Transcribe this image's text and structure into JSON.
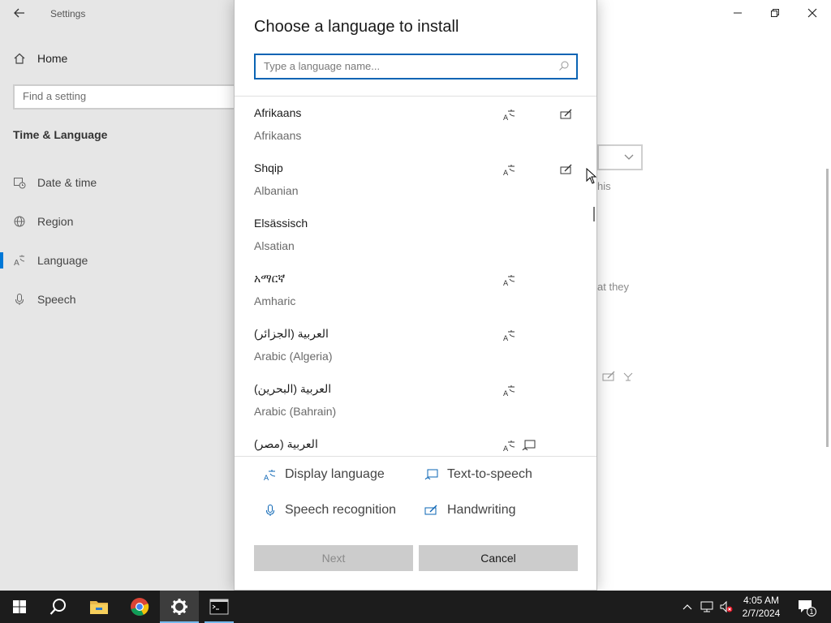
{
  "window": {
    "title": "Settings",
    "controls": {
      "minimize": "minimize",
      "restore": "restore",
      "close": "close"
    }
  },
  "nav": {
    "home": "Home",
    "search_placeholder": "Find a setting",
    "section_title": "Time & Language",
    "items": [
      {
        "label": "Date & time",
        "icon": "calendar-clock-icon",
        "active": false
      },
      {
        "label": "Region",
        "icon": "globe-icon",
        "active": false
      },
      {
        "label": "Language",
        "icon": "language-icon",
        "active": true
      },
      {
        "label": "Speech",
        "icon": "microphone-icon",
        "active": false
      }
    ]
  },
  "background_text": {
    "fragment1": "his",
    "fragment2": "at they"
  },
  "dialog": {
    "title": "Choose a language to install",
    "search_placeholder": "Type a language name...",
    "languages": [
      {
        "native": "Afrikaans",
        "english": "Afrikaans",
        "features": [
          "display-language",
          "handwriting"
        ]
      },
      {
        "native": "Shqip",
        "english": "Albanian",
        "features": [
          "display-language",
          "handwriting"
        ]
      },
      {
        "native": "Elsässisch",
        "english": "Alsatian",
        "features": []
      },
      {
        "native": "አማርኛ",
        "english": "Amharic",
        "features": [
          "display-language"
        ]
      },
      {
        "native": "العربية (الجزائر)",
        "english": "Arabic (Algeria)",
        "features": [
          "display-language"
        ]
      },
      {
        "native": "العربية (البحرين)",
        "english": "Arabic (Bahrain)",
        "features": [
          "display-language"
        ]
      },
      {
        "native": "العربية (مصر)",
        "english": "",
        "features": [
          "display-language",
          "text-to-speech"
        ]
      }
    ],
    "legend": {
      "display_language": "Display language",
      "text_to_speech": "Text-to-speech",
      "speech_recognition": "Speech recognition",
      "handwriting": "Handwriting"
    },
    "buttons": {
      "next": "Next",
      "cancel": "Cancel"
    }
  },
  "taskbar": {
    "apps": [
      "start",
      "search",
      "file-explorer",
      "chrome",
      "settings",
      "terminal"
    ],
    "time": "4:05 AM",
    "date": "2/7/2024",
    "notifications": "1"
  },
  "colors": {
    "accent": "#0078d7",
    "search_border": "#0a64b4",
    "taskbar": "#1c1c1c",
    "nav_bg": "#e6e6e6"
  }
}
